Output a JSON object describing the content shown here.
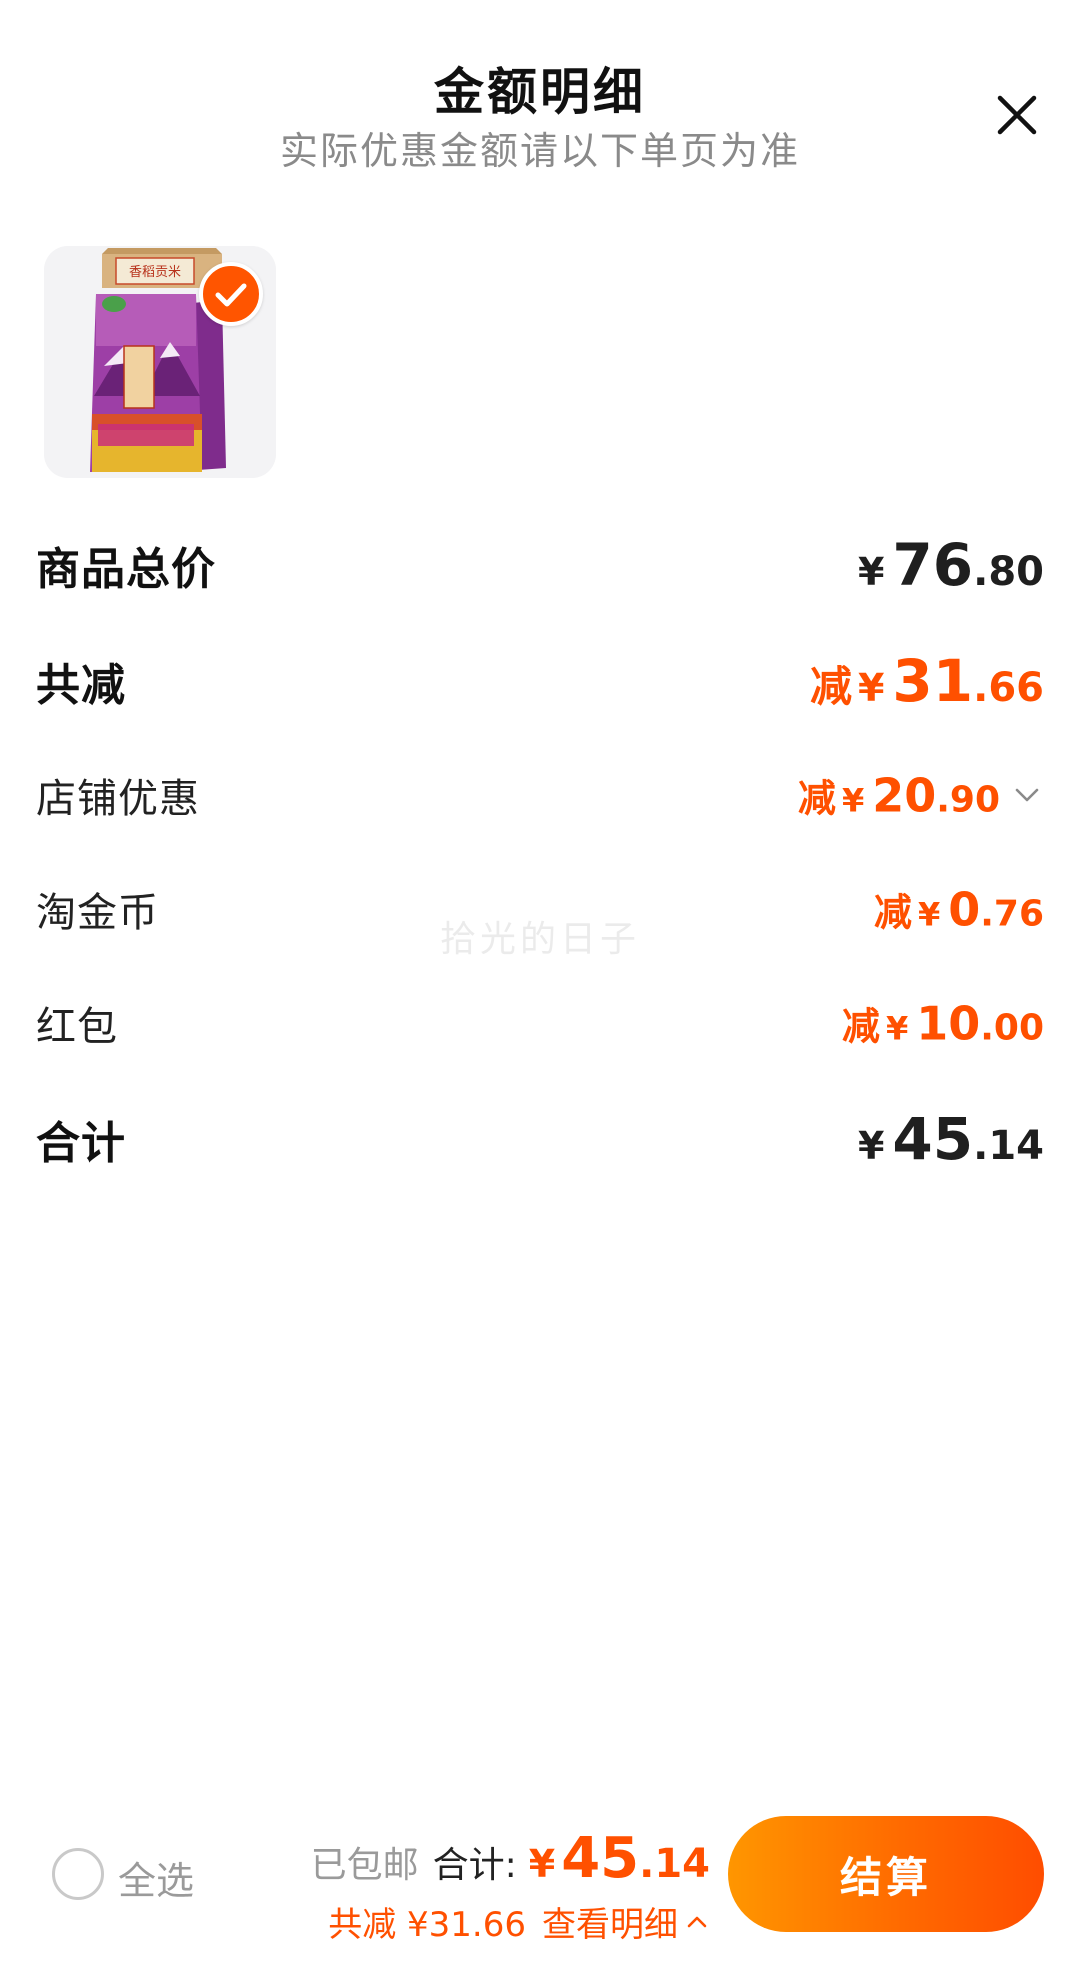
{
  "header": {
    "title": "金额明细",
    "subtitle": "实际优惠金额请以下单页为准"
  },
  "icons": {
    "close": "close-icon",
    "check": "check-icon",
    "chevron": "chevron-down-icon",
    "chevron_up": "chevron-up-icon"
  },
  "product": {
    "image_text": "香稻贡米",
    "selected": true
  },
  "rows": {
    "total_price": {
      "label": "商品总价",
      "yen": "¥",
      "int": "76",
      "dec": ".80"
    },
    "total_discount": {
      "label": "共减",
      "prefix": "减",
      "yen": "¥",
      "int": "31",
      "dec": ".66"
    },
    "store_discount": {
      "label": "店铺优惠",
      "prefix": "减",
      "yen": "¥",
      "int": "20",
      "dec": ".90"
    },
    "taojinbi": {
      "label": "淘金币",
      "prefix": "减",
      "yen": "¥",
      "int": "0",
      "dec": ".76"
    },
    "red_packet": {
      "label": "红包",
      "prefix": "减",
      "yen": "¥",
      "int": "10",
      "dec": ".00"
    },
    "grand_total": {
      "label": "合计",
      "yen": "¥",
      "int": "45",
      "dec": ".14"
    }
  },
  "watermark": "拾光的日子",
  "bottom_bar": {
    "select_all_label": "全选",
    "shipping": "已包邮",
    "total_label": "合计:",
    "total_yen": "¥",
    "total_int": "45",
    "total_dec": ".14",
    "discount_text": "共减 ¥31.66",
    "view_detail": "查看明细",
    "checkout_label": "结算"
  },
  "colors": {
    "accent": "#ff5000",
    "checkout_gradient_start": "#ff9600",
    "checkout_gradient_end": "#ff4d00",
    "text_primary": "#1f1f1f",
    "text_secondary": "#8a8a8a"
  }
}
